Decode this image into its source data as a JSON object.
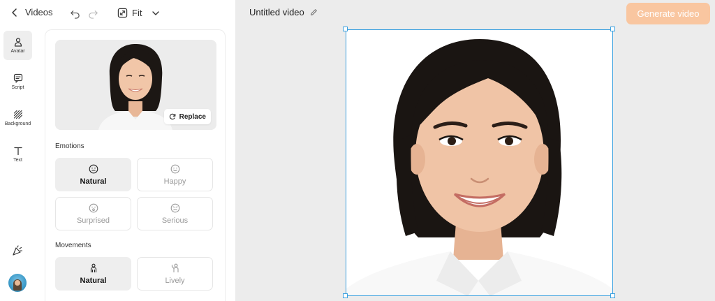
{
  "topbar": {
    "back_label": "Videos",
    "fit_label": "Fit"
  },
  "rail": {
    "items": [
      {
        "label": "Avatar",
        "icon": "person-icon",
        "active": true
      },
      {
        "label": "Script",
        "icon": "script-icon",
        "active": false
      },
      {
        "label": "Background",
        "icon": "background-icon",
        "active": false
      },
      {
        "label": "Text",
        "icon": "text-icon",
        "active": false
      }
    ],
    "bottom_icon": "celebrate-icon"
  },
  "panel": {
    "replace_label": "Replace",
    "emotions_label": "Emotions",
    "emotions": [
      {
        "label": "Natural",
        "icon": "neutral-face-icon",
        "selected": true
      },
      {
        "label": "Happy",
        "icon": "smile-face-icon",
        "selected": false
      },
      {
        "label": "Surprised",
        "icon": "surprised-face-icon",
        "selected": false
      },
      {
        "label": "Serious",
        "icon": "serious-face-icon",
        "selected": false
      }
    ],
    "movements_label": "Movements",
    "movements": [
      {
        "label": "Natural",
        "icon": "standing-person-icon",
        "selected": true
      },
      {
        "label": "Lively",
        "icon": "waving-person-icon",
        "selected": false
      }
    ]
  },
  "canvas": {
    "title": "Untitled video",
    "generate_label": "Generate video"
  },
  "colors": {
    "accent": "#39a0e0",
    "generate_button": "#f9c6a0",
    "selected_option": "#eeeeee",
    "canvas_bg": "#ececec"
  }
}
